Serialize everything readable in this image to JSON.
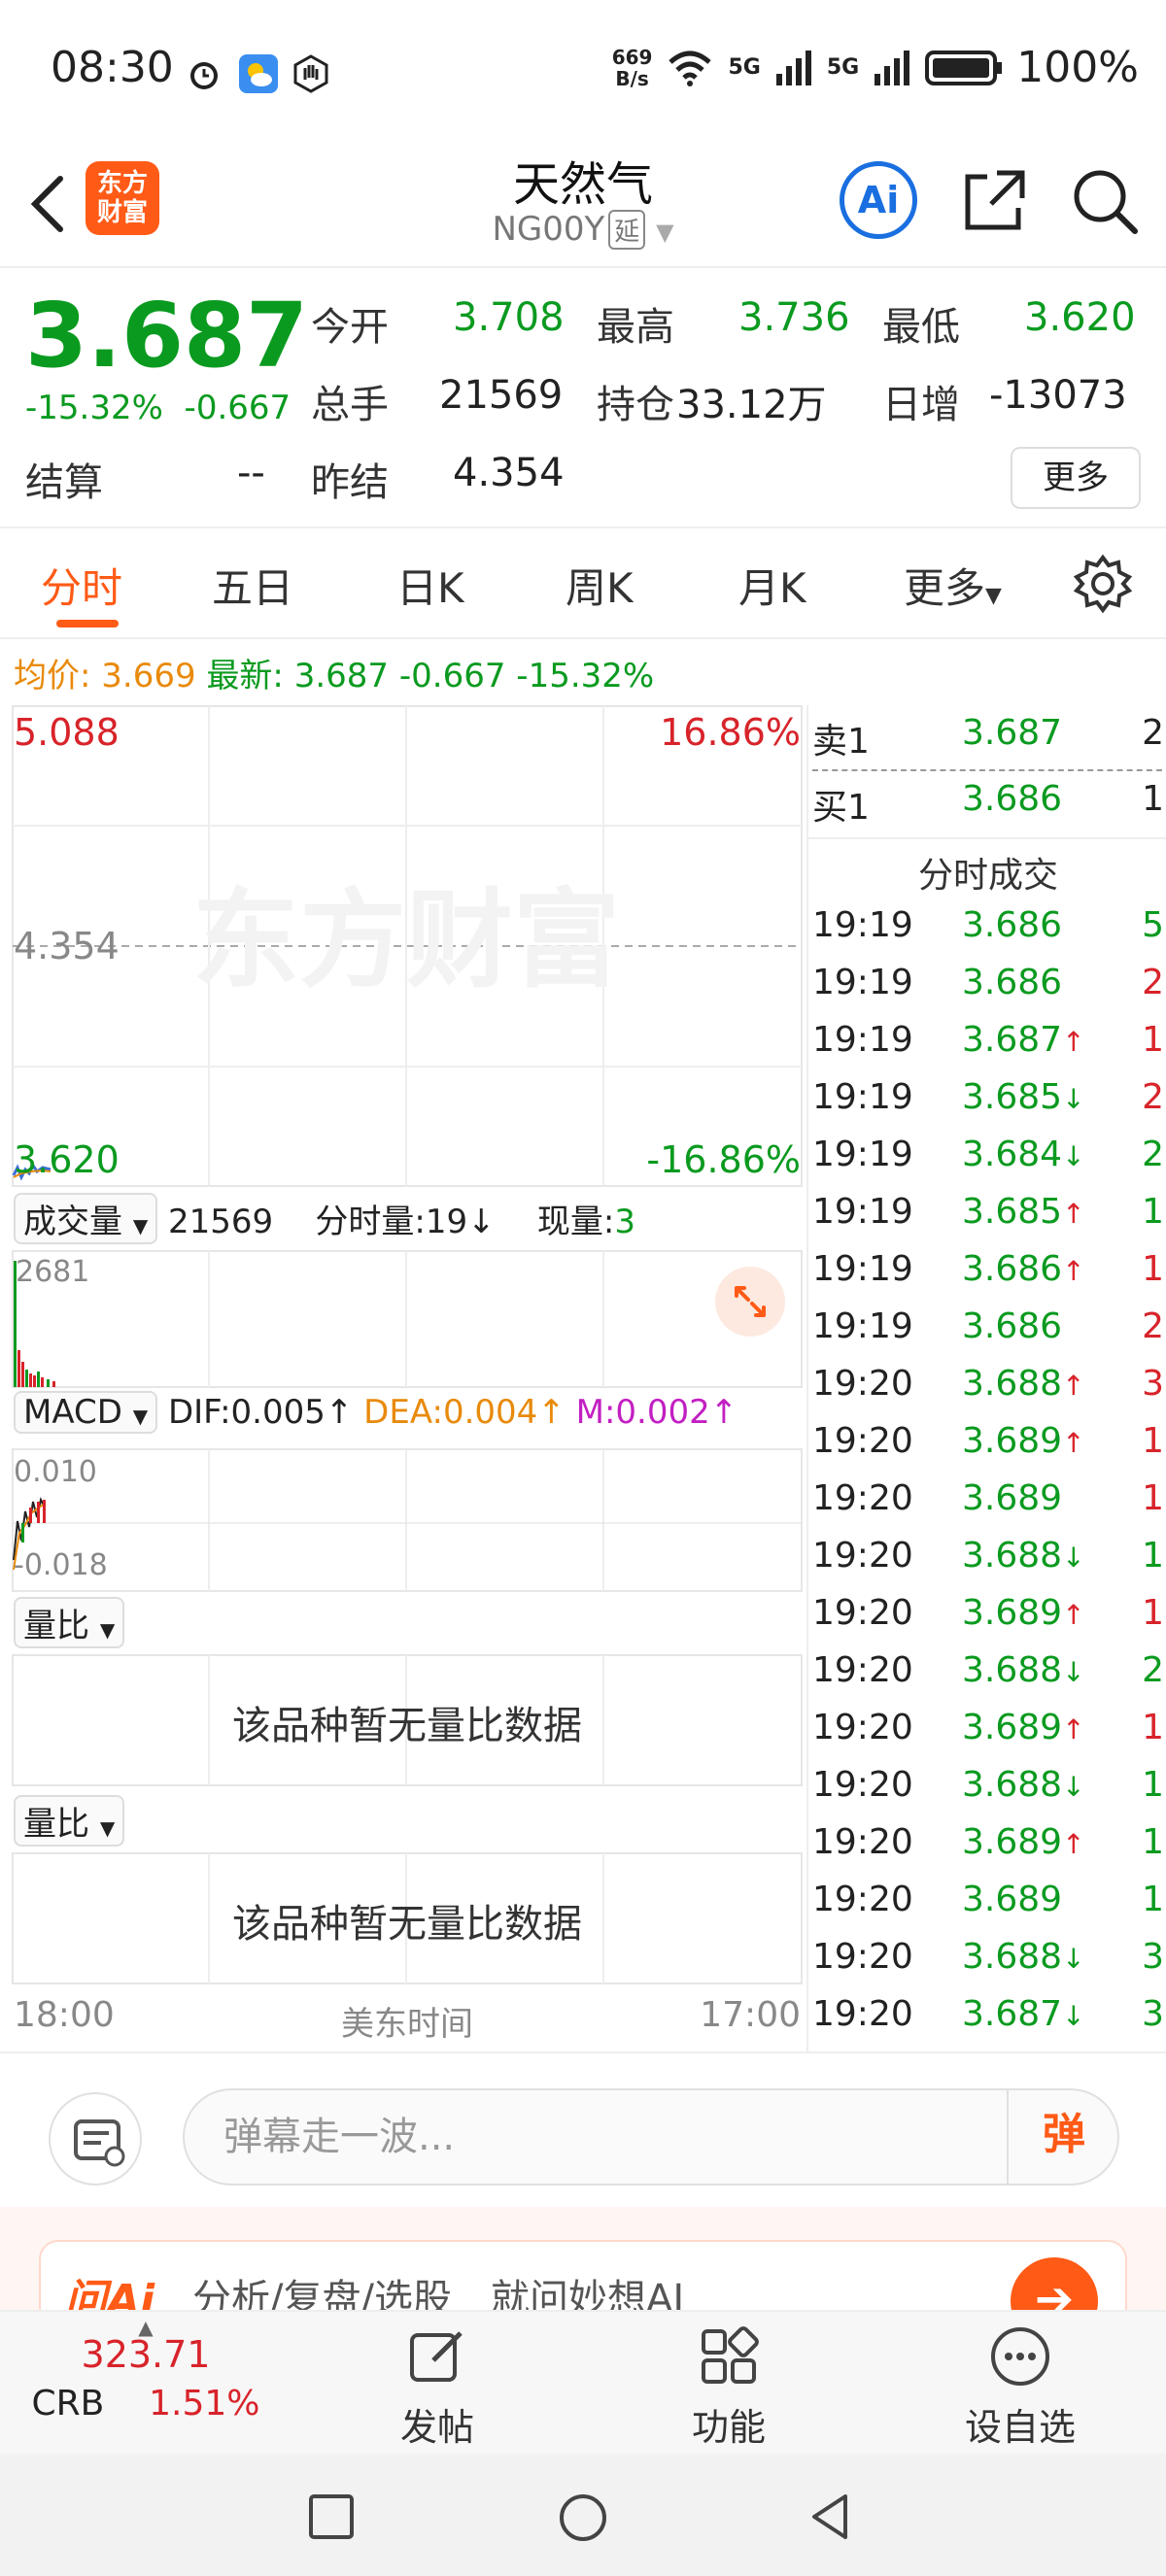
{
  "status_bar": {
    "time": "08:30",
    "net_speed_value": "669",
    "net_speed_unit": "B/s",
    "network1": "5G",
    "network2": "5G",
    "battery": "100%"
  },
  "header": {
    "logo_line1": "东方",
    "logo_line2": "财富",
    "title": "天然气",
    "code": "NG00Y",
    "delay_tag": "延",
    "ai_label": "Ai"
  },
  "quote": {
    "price": "3.687",
    "change_pct": "-15.32%",
    "change_amt": "-0.667",
    "open_label": "今开",
    "open": "3.708",
    "high_label": "最高",
    "high": "3.736",
    "low_label": "最低",
    "low": "3.620",
    "volume_label": "总手",
    "volume": "21569",
    "oi_label": "持仓",
    "oi": "33.12万",
    "daily_inc_label": "日增",
    "daily_inc": "-13073",
    "settle_label": "结算",
    "settle": "--",
    "prev_settle_label": "昨结",
    "prev_settle": "4.354",
    "more_button": "更多"
  },
  "tabs": [
    "分时",
    "五日",
    "日K",
    "周K",
    "月K",
    "更多"
  ],
  "avg_line": {
    "avg_label": "均价:",
    "avg": "3.669",
    "latest_label": "最新:",
    "latest": "3.687",
    "chg": "-0.667",
    "pct": "-15.32%"
  },
  "chart": {
    "watermark": "东方财富",
    "price_top": "5.088",
    "pct_top": "16.86%",
    "price_mid": "4.354",
    "price_bottom": "3.620",
    "pct_bottom": "-16.86%",
    "volume_header": {
      "label": "成交量",
      "total": "21569",
      "minute_label": "分时量:",
      "minute_value": "19",
      "minute_arrow": "↓",
      "current_label": "现量:",
      "current_value": "3"
    },
    "volume_max": "2681",
    "macd": {
      "label": "MACD",
      "dif": "DIF:0.005",
      "dea": "DEA:0.004",
      "m": "M:0.002",
      "arrow": "↑",
      "top": "0.010",
      "bottom": "-0.018"
    },
    "ratio1_label": "量比",
    "ratio1_nodata": "该品种暂无量比数据",
    "ratio2_label": "量比",
    "ratio2_nodata": "该品种暂无量比数据",
    "time_start": "18:00",
    "time_zone": "美东时间",
    "time_end": "17:00"
  },
  "order_book": {
    "ask_label": "卖1",
    "ask_price": "3.687",
    "ask_vol": "2",
    "bid_label": "买1",
    "bid_price": "3.686",
    "bid_vol": "1",
    "ticks_title": "分时成交"
  },
  "ticks": [
    {
      "time": "19:19",
      "price": "3.686",
      "arrow": "",
      "vol": "5",
      "vcolor": "green"
    },
    {
      "time": "19:19",
      "price": "3.686",
      "arrow": "",
      "vol": "2",
      "vcolor": "red"
    },
    {
      "time": "19:19",
      "price": "3.687",
      "arrow": "↑",
      "vol": "1",
      "vcolor": "red"
    },
    {
      "time": "19:19",
      "price": "3.685",
      "arrow": "↓",
      "vol": "2",
      "vcolor": "red"
    },
    {
      "time": "19:19",
      "price": "3.684",
      "arrow": "↓",
      "vol": "2",
      "vcolor": "green"
    },
    {
      "time": "19:19",
      "price": "3.685",
      "arrow": "↑",
      "vol": "1",
      "vcolor": "green"
    },
    {
      "time": "19:19",
      "price": "3.686",
      "arrow": "↑",
      "vol": "1",
      "vcolor": "red"
    },
    {
      "time": "19:19",
      "price": "3.686",
      "arrow": "",
      "vol": "2",
      "vcolor": "red"
    },
    {
      "time": "19:20",
      "price": "3.688",
      "arrow": "↑",
      "vol": "3",
      "vcolor": "red"
    },
    {
      "time": "19:20",
      "price": "3.689",
      "arrow": "↑",
      "vol": "1",
      "vcolor": "red"
    },
    {
      "time": "19:20",
      "price": "3.689",
      "arrow": "",
      "vol": "1",
      "vcolor": "red"
    },
    {
      "time": "19:20",
      "price": "3.688",
      "arrow": "↓",
      "vol": "1",
      "vcolor": "green"
    },
    {
      "time": "19:20",
      "price": "3.689",
      "arrow": "↑",
      "vol": "1",
      "vcolor": "red"
    },
    {
      "time": "19:20",
      "price": "3.688",
      "arrow": "↓",
      "vol": "2",
      "vcolor": "green"
    },
    {
      "time": "19:20",
      "price": "3.689",
      "arrow": "↑",
      "vol": "1",
      "vcolor": "red"
    },
    {
      "time": "19:20",
      "price": "3.688",
      "arrow": "↓",
      "vol": "1",
      "vcolor": "green"
    },
    {
      "time": "19:20",
      "price": "3.689",
      "arrow": "↑",
      "vol": "1",
      "vcolor": "green"
    },
    {
      "time": "19:20",
      "price": "3.689",
      "arrow": "",
      "vol": "1",
      "vcolor": "green"
    },
    {
      "time": "19:20",
      "price": "3.688",
      "arrow": "↓",
      "vol": "3",
      "vcolor": "green"
    },
    {
      "time": "19:20",
      "price": "3.687",
      "arrow": "↓",
      "vol": "3",
      "vcolor": "green"
    }
  ],
  "danmu": {
    "placeholder": "弹幕走一波...",
    "send": "弹"
  },
  "ai_banner": {
    "brand": "问Ai",
    "text": "分析/复盘/选股　就问妙想AI"
  },
  "toolbar": {
    "index_value": "323.71",
    "index_name": "CRB",
    "index_pct": "1.51%",
    "post": "发帖",
    "func": "功能",
    "watch": "设自选"
  },
  "colors": {
    "up": "#d8232a",
    "down": "#0a9a1f",
    "accent": "#ff5a16",
    "avg": "#e88a0b",
    "m": "#c21fc2",
    "ai_blue": "#1a6fe0"
  }
}
